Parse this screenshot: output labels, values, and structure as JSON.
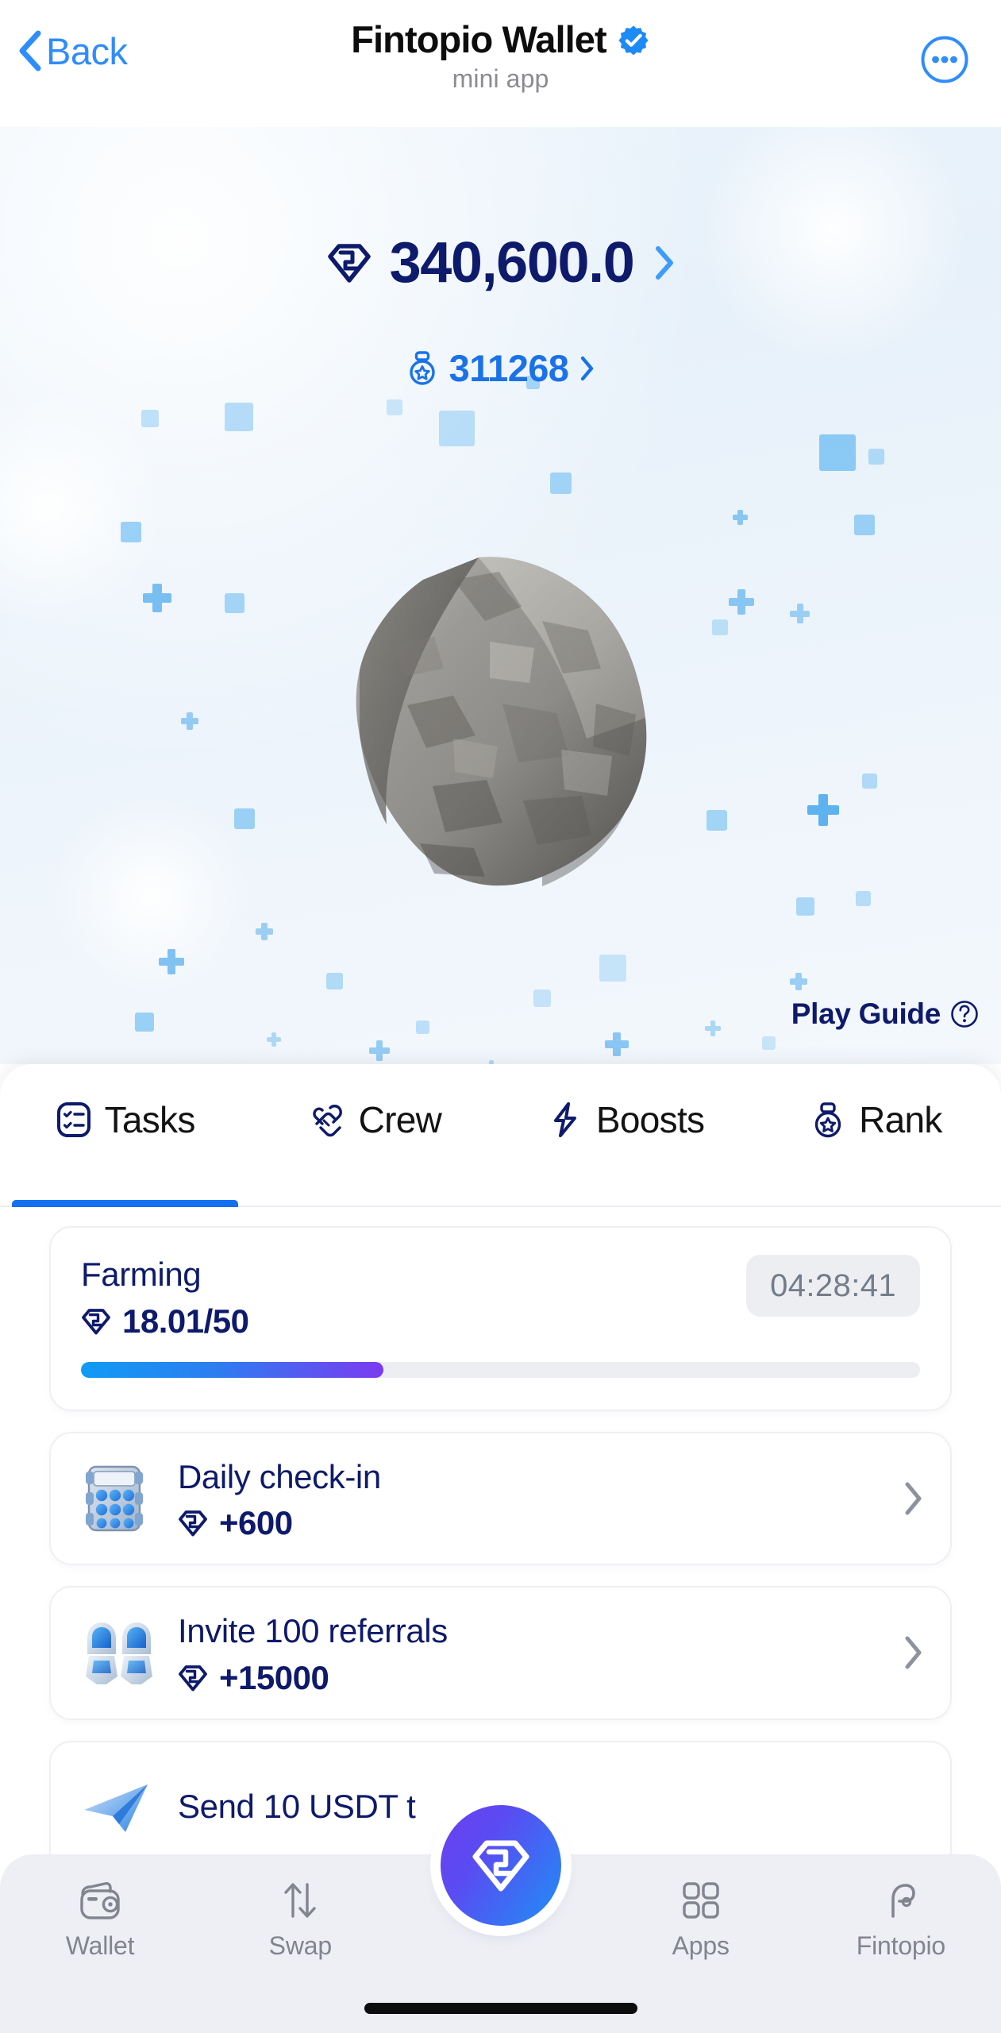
{
  "header": {
    "back_label": "Back",
    "title": "Fintopio Wallet",
    "subtitle": "mini app",
    "verified_icon": "verified-badge-icon",
    "menu_icon": "more-options-icon",
    "back_icon": "chevron-left-icon"
  },
  "hero": {
    "balance": "340,600.0",
    "balance_icon": "gem-icon",
    "balance_chevron": "chevron-right-icon",
    "rank": "311268",
    "rank_icon": "medal-icon",
    "rank_chevron": "chevron-right-icon",
    "rock_icon": "asteroid-rock-image",
    "play_guide_label": "Play Guide",
    "play_guide_icon": "help-circle-icon"
  },
  "tabs": [
    {
      "label": "Tasks",
      "icon": "checklist-icon",
      "active": true
    },
    {
      "label": "Crew",
      "icon": "handshake-icon",
      "active": false
    },
    {
      "label": "Boosts",
      "icon": "lightning-icon",
      "active": false
    },
    {
      "label": "Rank",
      "icon": "medal-icon",
      "active": false
    }
  ],
  "farming": {
    "title": "Farming",
    "amount": "18.01/50",
    "amount_icon": "gem-icon",
    "timer": "04:28:41",
    "progress_percent": 36
  },
  "tasks": [
    {
      "title": "Daily check-in",
      "reward": "+600",
      "reward_icon": "gem-icon",
      "thumb_icon": "daily-calendar-icon",
      "chevron_icon": "chevron-right-icon"
    },
    {
      "title": "Invite 100 referrals",
      "reward": "+15000",
      "reward_icon": "gem-icon",
      "thumb_icon": "referral-robots-icon",
      "chevron_icon": "chevron-right-icon"
    },
    {
      "title": "Send 10 USDT t",
      "reward": "",
      "reward_icon": "gem-icon",
      "thumb_icon": "paper-plane-icon",
      "chevron_icon": "chevron-right-icon"
    }
  ],
  "bottom_nav": [
    {
      "label": "Wallet",
      "icon": "wallet-icon"
    },
    {
      "label": "Swap",
      "icon": "swap-arrows-icon"
    },
    {
      "label": "Apps",
      "icon": "grid-apps-icon"
    },
    {
      "label": "Fintopio",
      "icon": "fintopio-logo-icon"
    }
  ],
  "fab": {
    "icon": "gem-icon"
  },
  "colors": {
    "accent_blue": "#1370f1",
    "link_blue": "#2f8cfb",
    "navy": "#0e1a6b",
    "rank_blue": "#1b72e8",
    "progress_start": "#0f9bf5",
    "progress_end": "#7b3bf0",
    "nav_bg": "#eeeff4",
    "muted_text": "#81858f"
  }
}
